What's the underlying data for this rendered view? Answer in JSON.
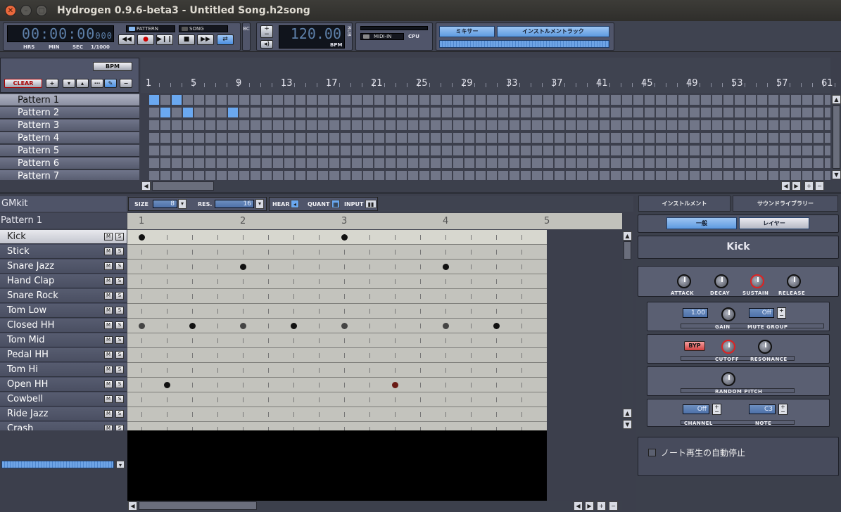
{
  "window": {
    "title": "Hydrogen 0.9.6-beta3 - Untitled Song.h2song"
  },
  "transport": {
    "time": "00:00:00",
    "time_ms": "000",
    "hrs": "HRS",
    "min": "MIN",
    "sec": "SEC",
    "ms_label": "1/1000",
    "pattern_mode": "PATTERN",
    "song_mode": "SONG",
    "bpm_value": "120.00",
    "bpm_unit": "BPM",
    "rub": "RUB",
    "bc": "BC",
    "midi_in": "MIDI-IN",
    "cpu": "CPU",
    "mixer": "ミキサー",
    "instrument_rack": "インストルメントラック"
  },
  "song_editor": {
    "bpm_btn": "BPM",
    "clear_btn": "CLEAR",
    "ruler": [
      "1",
      "5",
      "9",
      "13",
      "17",
      "21",
      "25",
      "29",
      "33",
      "37",
      "41",
      "45",
      "49",
      "53",
      "57",
      "61"
    ],
    "patterns": [
      "Pattern 1",
      "Pattern 2",
      "Pattern 3",
      "Pattern 4",
      "Pattern 5",
      "Pattern 6",
      "Pattern 7"
    ],
    "active_cells": [
      [
        0,
        0
      ],
      [
        0,
        2
      ],
      [
        1,
        1
      ],
      [
        1,
        3
      ],
      [
        1,
        7
      ]
    ]
  },
  "pattern_editor": {
    "drumkit": "GMkit",
    "pattern_name": "Pattern 1",
    "size_label": "SIZE",
    "size_value": "8",
    "res_label": "RES.",
    "res_value": "16",
    "hear_label": "HEAR",
    "quant_label": "QUANT",
    "input_label": "INPUT",
    "beats": [
      "1",
      "2",
      "3",
      "4",
      "5"
    ],
    "instruments": [
      "Kick",
      "Stick",
      "Snare Jazz",
      "Hand Clap",
      "Snare Rock",
      "Tom Low",
      "Closed HH",
      "Tom Mid",
      "Pedal HH",
      "Tom Hi",
      "Open HH",
      "Cowbell",
      "Ride Jazz",
      "Crash"
    ],
    "mute": "M",
    "solo": "S",
    "notes": [
      [
        0,
        0
      ],
      [
        0,
        8
      ],
      [
        2,
        4
      ],
      [
        2,
        12
      ],
      [
        6,
        0
      ],
      [
        6,
        2
      ],
      [
        6,
        4
      ],
      [
        6,
        6
      ],
      [
        6,
        8
      ],
      [
        6,
        12
      ],
      [
        6,
        14
      ],
      [
        10,
        1
      ],
      [
        10,
        10
      ]
    ]
  },
  "instrument_panel": {
    "tab_instrument": "インストルメント",
    "tab_library": "サウンドライブラリー",
    "sub_general": "一般",
    "sub_layer": "レイヤー",
    "instrument_name": "Kick",
    "attack": "ATTACK",
    "decay": "DECAY",
    "sustain": "SUSTAIN",
    "release": "RELEASE",
    "gain_value": "1.00",
    "gain": "GAIN",
    "mute_group_value": "Off",
    "mute_group": "MUTE GROUP",
    "byp": "BYP",
    "cutoff": "CUTOFF",
    "resonance": "RESONANCE",
    "random_pitch": "RANDOM PITCH",
    "channel_value": "Off",
    "channel": "CHANNEL",
    "note_value": "C3",
    "note": "NOTE",
    "auto_stop": "ノート再生の自動停止"
  }
}
